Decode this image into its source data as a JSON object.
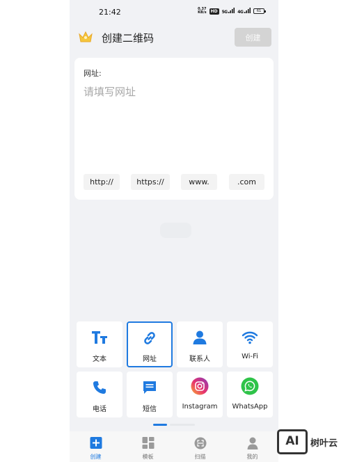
{
  "status_bar": {
    "time": "21:42",
    "net_speed_value": "0.37",
    "net_speed_unit": "KB/s",
    "hd_tag": "HD",
    "signal_1": "5G",
    "signal_2": "4G",
    "battery": "61"
  },
  "header": {
    "title": "创建二维码",
    "create_label": "创建"
  },
  "url_card": {
    "label": "网址:",
    "placeholder": "请填写网址",
    "value": "",
    "chips": [
      "http://",
      "https://",
      "www.",
      ".com"
    ]
  },
  "type_grid": {
    "selected": "网址",
    "tiles": [
      {
        "label": "文本",
        "icon": "text-icon"
      },
      {
        "label": "网址",
        "icon": "link-icon"
      },
      {
        "label": "联系人",
        "icon": "contact-icon"
      },
      {
        "label": "Wi-Fi",
        "icon": "wifi-icon"
      },
      {
        "label": "电话",
        "icon": "phone-icon"
      },
      {
        "label": "短信",
        "icon": "sms-icon"
      },
      {
        "label": "Instagram",
        "icon": "instagram-icon"
      },
      {
        "label": "WhatsApp",
        "icon": "whatsapp-icon"
      }
    ]
  },
  "tab_bar": {
    "active": "创建",
    "tabs": [
      {
        "label": "创建",
        "icon": "plus-icon"
      },
      {
        "label": "模板",
        "icon": "grid-icon"
      },
      {
        "label": "扫描",
        "icon": "scan-icon"
      },
      {
        "label": "我的",
        "icon": "user-icon"
      }
    ]
  },
  "watermark": {
    "badge": "AI",
    "text": "树叶云"
  },
  "colors": {
    "accent": "#1f7ae0",
    "background": "#f1f2f5",
    "disabled_button": "#d4d4d4",
    "crown": "#f5c63c"
  }
}
